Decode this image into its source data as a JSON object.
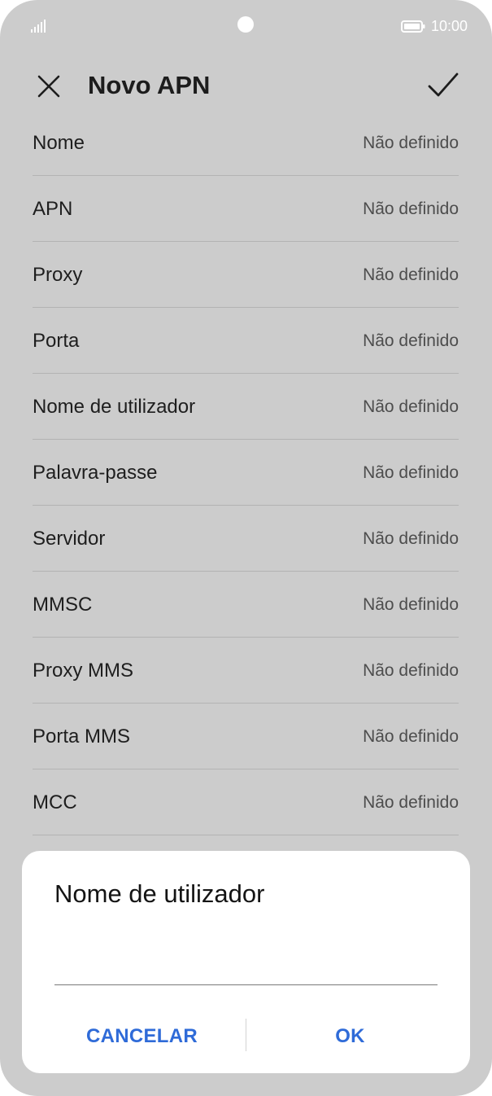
{
  "status_bar": {
    "time": "10:00",
    "icons": [
      "signal-icon",
      "camera-cutout",
      "battery-icon"
    ]
  },
  "header": {
    "title": "Novo APN",
    "close_icon": "close-icon",
    "confirm_icon": "check-icon"
  },
  "fields": [
    {
      "label": "Nome",
      "value": "Não definido"
    },
    {
      "label": "APN",
      "value": "Não definido"
    },
    {
      "label": "Proxy",
      "value": "Não definido"
    },
    {
      "label": "Porta",
      "value": "Não definido"
    },
    {
      "label": "Nome de utilizador",
      "value": "Não definido"
    },
    {
      "label": "Palavra-passe",
      "value": "Não definido"
    },
    {
      "label": "Servidor",
      "value": "Não definido"
    },
    {
      "label": "MMSC",
      "value": "Não definido"
    },
    {
      "label": "Proxy MMS",
      "value": "Não definido"
    },
    {
      "label": "Porta MMS",
      "value": "Não definido"
    },
    {
      "label": "MCC",
      "value": "Não definido"
    }
  ],
  "dialog": {
    "title": "Nome de utilizador",
    "input_value": "",
    "cancel_label": "CANCELAR",
    "ok_label": "OK"
  },
  "colors": {
    "background_dim": "#cccccc",
    "accent": "#2f6bd8",
    "dialog_bg": "#ffffff"
  }
}
